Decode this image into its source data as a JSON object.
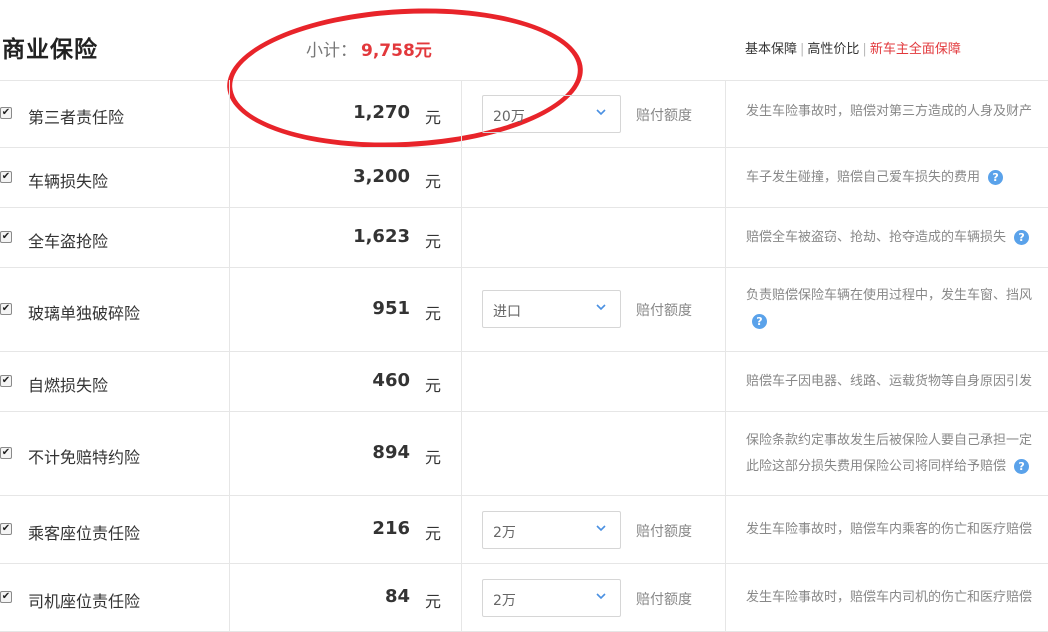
{
  "header": {
    "title": "商业保险",
    "subtotal_label": "小计：",
    "subtotal_value": "9,758元",
    "links": [
      "基本保障",
      "高性价比",
      "新车主全面保障"
    ]
  },
  "unit": "元",
  "amount_label": "赔付额度",
  "rows": [
    {
      "name": "第三者责任险",
      "price": "1,270",
      "select": "20万",
      "desc": [
        "发生车险事故时，赔偿对第三方造成的人身及财产"
      ]
    },
    {
      "name": "车辆损失险",
      "price": "3,200",
      "desc": [
        "车子发生碰撞，赔偿自己爱车损失的费用"
      ]
    },
    {
      "name": "全车盗抢险",
      "price": "1,623",
      "desc": [
        "赔偿全车被盗窃、抢劫、抢夺造成的车辆损失"
      ]
    },
    {
      "name": "玻璃单独破碎险",
      "price": "951",
      "select": "进口",
      "desc": [
        "负责赔偿保险车辆在使用过程中，发生车窗、挡风"
      ]
    },
    {
      "name": "自燃损失险",
      "price": "460",
      "desc": [
        "赔偿车子因电器、线路、运载货物等自身原因引发"
      ]
    },
    {
      "name": "不计免赔特约险",
      "price": "894",
      "desc": [
        "保险条款约定事故发生后被保险人要自己承担一定",
        "此险这部分损失费用保险公司将同样给予赔偿"
      ]
    },
    {
      "name": "乘客座位责任险",
      "price": "216",
      "select": "2万",
      "desc": [
        "发生车险事故时，赔偿车内乘客的伤亡和医疗赔偿"
      ]
    },
    {
      "name": "司机座位责任险",
      "price": "84",
      "select": "2万",
      "desc": [
        "发生车险事故时，赔偿车内司机的伤亡和医疗赔偿"
      ]
    }
  ],
  "colors": {
    "accent": "#e2383c",
    "annotation": "#e8242a",
    "help_icon": "#5aa2ea"
  }
}
